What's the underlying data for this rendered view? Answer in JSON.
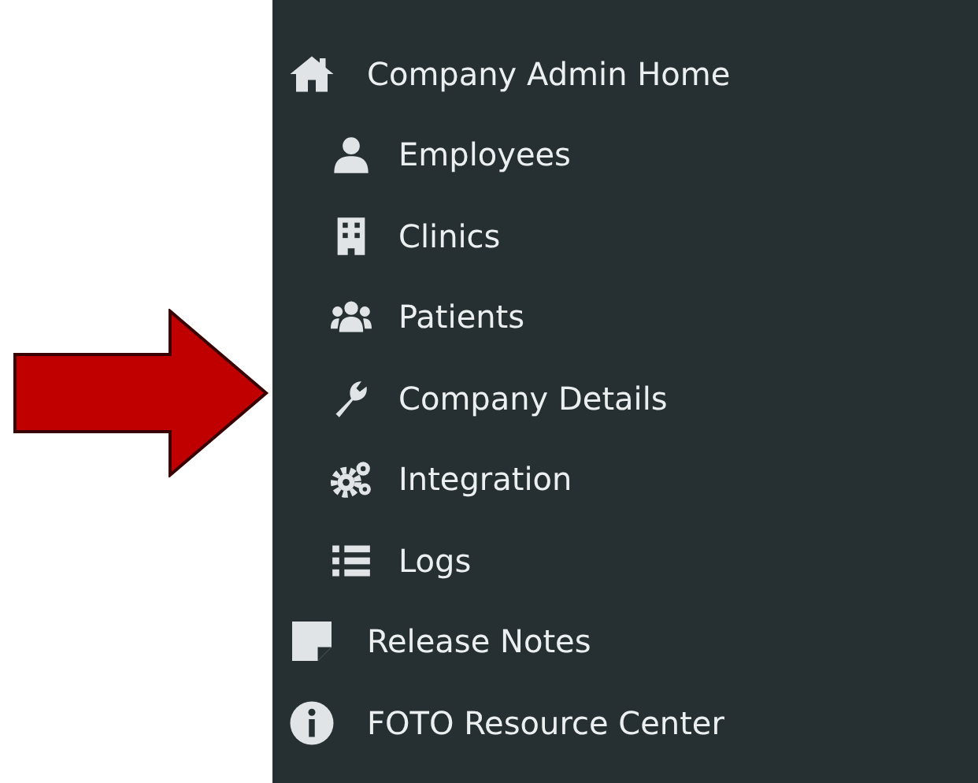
{
  "sidebar": {
    "items": [
      {
        "label": "Company Admin Home",
        "children": [
          {
            "label": "Employees"
          },
          {
            "label": "Clinics"
          },
          {
            "label": "Patients"
          },
          {
            "label": "Company Details"
          },
          {
            "label": "Integration"
          },
          {
            "label": "Logs"
          }
        ]
      },
      {
        "label": "Release Notes"
      },
      {
        "label": "FOTO Resource Center"
      }
    ]
  }
}
